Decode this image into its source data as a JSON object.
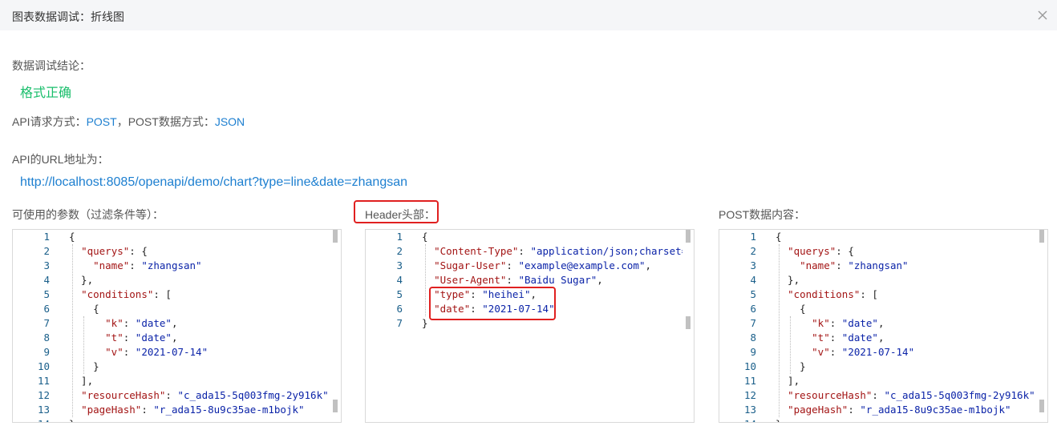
{
  "dialog": {
    "title": "图表数据调试：折线图"
  },
  "result_section": {
    "label": "数据调试结论：",
    "value": "格式正确",
    "value_color": "#19be6b"
  },
  "api": {
    "method_label": "API请求方式：",
    "method_value": "POST",
    "separator": "，",
    "format_label": "POST数据方式：",
    "format_value": "JSON",
    "url_label": "API的URL地址为：",
    "url": "http://localhost:8085/openapi/demo/chart?type=line&date=zhangsan"
  },
  "panels": {
    "params": {
      "label": "可使用的参数（过滤条件等）：",
      "lines": [
        [
          {
            "t": "p",
            "v": "{"
          }
        ],
        [
          {
            "t": "p",
            "v": "  "
          },
          {
            "t": "k",
            "v": "\"querys\""
          },
          {
            "t": "p",
            "v": ": {"
          }
        ],
        [
          {
            "t": "p",
            "v": "    "
          },
          {
            "t": "k",
            "v": "\"name\""
          },
          {
            "t": "p",
            "v": ": "
          },
          {
            "t": "s",
            "v": "\"zhangsan\""
          }
        ],
        [
          {
            "t": "p",
            "v": "  },"
          }
        ],
        [
          {
            "t": "p",
            "v": "  "
          },
          {
            "t": "k",
            "v": "\"conditions\""
          },
          {
            "t": "p",
            "v": ": ["
          }
        ],
        [
          {
            "t": "p",
            "v": "    {"
          }
        ],
        [
          {
            "t": "p",
            "v": "      "
          },
          {
            "t": "k",
            "v": "\"k\""
          },
          {
            "t": "p",
            "v": ": "
          },
          {
            "t": "s",
            "v": "\"date\""
          },
          {
            "t": "p",
            "v": ","
          }
        ],
        [
          {
            "t": "p",
            "v": "      "
          },
          {
            "t": "k",
            "v": "\"t\""
          },
          {
            "t": "p",
            "v": ": "
          },
          {
            "t": "s",
            "v": "\"date\""
          },
          {
            "t": "p",
            "v": ","
          }
        ],
        [
          {
            "t": "p",
            "v": "      "
          },
          {
            "t": "k",
            "v": "\"v\""
          },
          {
            "t": "p",
            "v": ": "
          },
          {
            "t": "s",
            "v": "\"2021-07-14\""
          }
        ],
        [
          {
            "t": "p",
            "v": "    }"
          }
        ],
        [
          {
            "t": "p",
            "v": "  ],"
          }
        ],
        [
          {
            "t": "p",
            "v": "  "
          },
          {
            "t": "k",
            "v": "\"resourceHash\""
          },
          {
            "t": "p",
            "v": ": "
          },
          {
            "t": "s",
            "v": "\"c_ada15-5q003fmg-2y916k\""
          },
          {
            "t": "p",
            "v": ","
          }
        ],
        [
          {
            "t": "p",
            "v": "  "
          },
          {
            "t": "k",
            "v": "\"pageHash\""
          },
          {
            "t": "p",
            "v": ": "
          },
          {
            "t": "s",
            "v": "\"r_ada15-8u9c35ae-m1bojk\""
          }
        ],
        [
          {
            "t": "p",
            "v": "}"
          }
        ]
      ]
    },
    "header": {
      "label": "Header头部：",
      "lines": [
        [
          {
            "t": "p",
            "v": "{"
          }
        ],
        [
          {
            "t": "p",
            "v": "  "
          },
          {
            "t": "k",
            "v": "\"Content-Type\""
          },
          {
            "t": "p",
            "v": ": "
          },
          {
            "t": "s",
            "v": "\"application/json;charset=UTF"
          }
        ],
        [
          {
            "t": "p",
            "v": "  "
          },
          {
            "t": "k",
            "v": "\"Sugar-User\""
          },
          {
            "t": "p",
            "v": ": "
          },
          {
            "t": "s",
            "v": "\"example@example.com\""
          },
          {
            "t": "p",
            "v": ","
          }
        ],
        [
          {
            "t": "p",
            "v": "  "
          },
          {
            "t": "k",
            "v": "\"User-Agent\""
          },
          {
            "t": "p",
            "v": ": "
          },
          {
            "t": "s",
            "v": "\"Baidu Sugar\""
          },
          {
            "t": "p",
            "v": ","
          }
        ],
        [
          {
            "t": "p",
            "v": "  "
          },
          {
            "t": "k",
            "v": "\"type\""
          },
          {
            "t": "p",
            "v": ": "
          },
          {
            "t": "s",
            "v": "\"heihei\""
          },
          {
            "t": "p",
            "v": ","
          }
        ],
        [
          {
            "t": "p",
            "v": "  "
          },
          {
            "t": "k",
            "v": "\"date\""
          },
          {
            "t": "p",
            "v": ": "
          },
          {
            "t": "s",
            "v": "\"2021-07-14\""
          }
        ],
        [
          {
            "t": "p",
            "v": "}"
          }
        ]
      ]
    },
    "post": {
      "label": "POST数据内容：",
      "lines": [
        [
          {
            "t": "p",
            "v": "{"
          }
        ],
        [
          {
            "t": "p",
            "v": "  "
          },
          {
            "t": "k",
            "v": "\"querys\""
          },
          {
            "t": "p",
            "v": ": {"
          }
        ],
        [
          {
            "t": "p",
            "v": "    "
          },
          {
            "t": "k",
            "v": "\"name\""
          },
          {
            "t": "p",
            "v": ": "
          },
          {
            "t": "s",
            "v": "\"zhangsan\""
          }
        ],
        [
          {
            "t": "p",
            "v": "  },"
          }
        ],
        [
          {
            "t": "p",
            "v": "  "
          },
          {
            "t": "k",
            "v": "\"conditions\""
          },
          {
            "t": "p",
            "v": ": ["
          }
        ],
        [
          {
            "t": "p",
            "v": "    {"
          }
        ],
        [
          {
            "t": "p",
            "v": "      "
          },
          {
            "t": "k",
            "v": "\"k\""
          },
          {
            "t": "p",
            "v": ": "
          },
          {
            "t": "s",
            "v": "\"date\""
          },
          {
            "t": "p",
            "v": ","
          }
        ],
        [
          {
            "t": "p",
            "v": "      "
          },
          {
            "t": "k",
            "v": "\"t\""
          },
          {
            "t": "p",
            "v": ": "
          },
          {
            "t": "s",
            "v": "\"date\""
          },
          {
            "t": "p",
            "v": ","
          }
        ],
        [
          {
            "t": "p",
            "v": "      "
          },
          {
            "t": "k",
            "v": "\"v\""
          },
          {
            "t": "p",
            "v": ": "
          },
          {
            "t": "s",
            "v": "\"2021-07-14\""
          }
        ],
        [
          {
            "t": "p",
            "v": "    }"
          }
        ],
        [
          {
            "t": "p",
            "v": "  ],"
          }
        ],
        [
          {
            "t": "p",
            "v": "  "
          },
          {
            "t": "k",
            "v": "\"resourceHash\""
          },
          {
            "t": "p",
            "v": ": "
          },
          {
            "t": "s",
            "v": "\"c_ada15-5q003fmg-2y916k\""
          },
          {
            "t": "p",
            "v": ","
          }
        ],
        [
          {
            "t": "p",
            "v": "  "
          },
          {
            "t": "k",
            "v": "\"pageHash\""
          },
          {
            "t": "p",
            "v": ": "
          },
          {
            "t": "s",
            "v": "\"r_ada15-8u9c35ae-m1bojk\""
          }
        ],
        [
          {
            "t": "p",
            "v": "}"
          }
        ]
      ]
    }
  },
  "colors": {
    "link": "#1d7fd0",
    "success": "#19be6b",
    "highlight": "#e02020",
    "json_key": "#a31515",
    "json_string": "#0b23a8",
    "line_number": "#1a5f8a"
  }
}
